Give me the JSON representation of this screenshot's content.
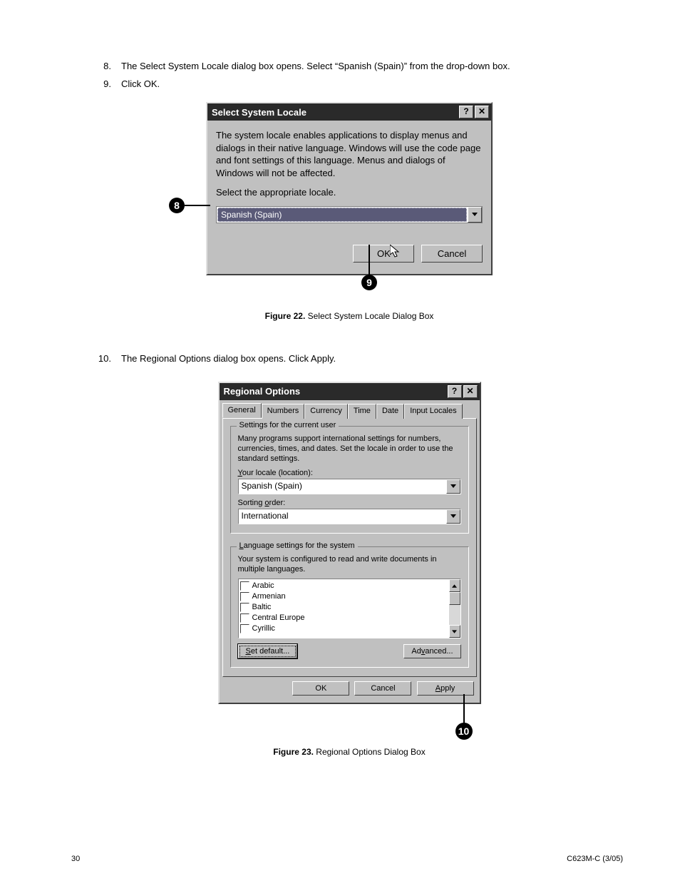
{
  "footer": {
    "page": "30",
    "doc_id": "C623M-C (3/05)"
  },
  "steps": {
    "s8_num": "8.",
    "s8_text": "The Select System Locale dialog box opens. Select “Spanish (Spain)” from the drop-down box.",
    "s9_num": "9.",
    "s9_text": "Click OK.",
    "s10_num": "10.",
    "s10_text": "The Regional Options dialog box opens. Click Apply."
  },
  "figure22": {
    "caption_bold": "Figure 22.",
    "caption_rest": "  Select System Locale Dialog Box",
    "badge8": "8",
    "badge9": "9",
    "dlg": {
      "title": "Select System Locale",
      "help": "?",
      "close": "✕",
      "para1": "The system locale enables applications to display menus and dialogs in their native language.  Windows will use the code page and font settings of this language.  Menus and dialogs of Windows will not be affected.",
      "para2": "Select the appropriate locale.",
      "selected": "Spanish (Spain)",
      "ok": "OK",
      "cancel": "Cancel"
    }
  },
  "figure23": {
    "caption_bold": "Figure 23.",
    "caption_rest": "  Regional Options Dialog Box",
    "badge10": "10",
    "dlg": {
      "title": "Regional Options",
      "help": "?",
      "close": "✕",
      "tabs": {
        "general": "General",
        "numbers": "Numbers",
        "currency": "Currency",
        "time": "Time",
        "date": "Date",
        "input": "Input Locales"
      },
      "group1": {
        "legend": "Settings for the current user",
        "desc": "Many programs support international settings for numbers, currencies, times, and dates. Set the locale in order to use the standard settings.",
        "locale_label_pre": "Y",
        "locale_label_rest": "our locale (location):",
        "locale_value": "Spanish (Spain)",
        "sorting_pre": "Sorting ",
        "sorting_u": "o",
        "sorting_post": "rder:",
        "sorting_value": "International"
      },
      "group2": {
        "legend_u": "L",
        "legend_rest": "anguage settings for the system",
        "desc": "Your system is configured to read and write documents in multiple languages.",
        "items": {
          "i0": "Arabic",
          "i1": "Armenian",
          "i2": "Baltic",
          "i3": "Central Europe",
          "i4": "Cyrillic"
        },
        "setdefault_u": "S",
        "setdefault_rest": "et default...",
        "advanced": "Ad",
        "advanced_u": "v",
        "advanced_post": "anced..."
      },
      "ok": "OK",
      "cancel": "Cancel",
      "apply_u": "A",
      "apply_rest": "pply"
    }
  }
}
